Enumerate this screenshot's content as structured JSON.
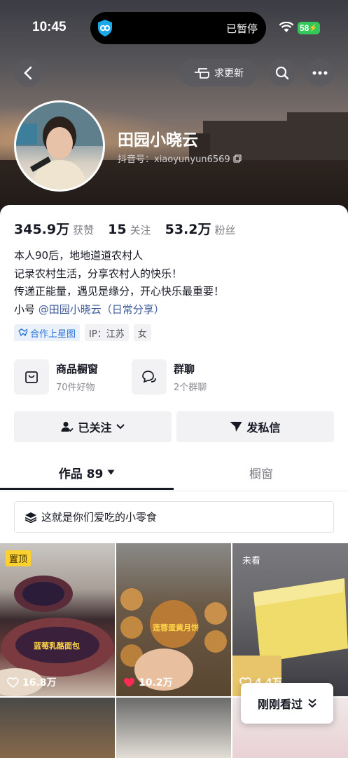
{
  "status_bar": {
    "time": "10:45",
    "island_text": "已暂停",
    "battery": "58"
  },
  "top_bar": {
    "update_label": "求更新"
  },
  "profile": {
    "name": "田园小晓云",
    "douyin_id": "抖音号：xiaoyunyun6569"
  },
  "stats": [
    {
      "value": "345.9万",
      "label": "获赞"
    },
    {
      "value": "15",
      "label": "关注"
    },
    {
      "value": "53.2万",
      "label": "粉丝"
    }
  ],
  "bio": {
    "line1": "本人90后，地地道道农村人",
    "line2": "记录农村生活，分享农村人的快乐！",
    "line3": "传递正能量，遇见是缘分，开心快乐最重要！",
    "alt_prefix": "小号 ",
    "alt_link": "@田园小晓云（日常分享）"
  },
  "tags": [
    "合作上星图",
    "IP：江苏",
    "女"
  ],
  "features": [
    {
      "title": "商品橱窗",
      "sub": "70件好物"
    },
    {
      "title": "群聊",
      "sub": "2个群聊"
    }
  ],
  "actions": {
    "followed": "已关注",
    "message": "发私信"
  },
  "tabs": {
    "works": "作品 89",
    "shop": "橱窗"
  },
  "collection": "这就是你们爱吃的小零食",
  "videos": [
    {
      "badge": "置顶",
      "likes": "16.8万",
      "caption": "蓝莓乳酪面包"
    },
    {
      "likes": "10.2万",
      "caption": "莲蓉蛋黄月饼"
    },
    {
      "badge": "未看",
      "likes": "4.4万"
    }
  ],
  "recent_button": "刚刚看过"
}
